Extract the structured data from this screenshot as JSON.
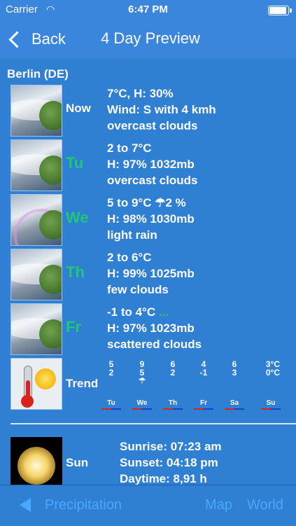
{
  "status": {
    "carrier": "Carrier",
    "time": "6:47 PM"
  },
  "nav": {
    "back_label": "Back",
    "title": "4 Day Preview"
  },
  "city": "Berlin (DE)",
  "rows": [
    {
      "day": "Now",
      "lines": [
        "7°C, H: 30%",
        "Wind: S with 4 kmh",
        "overcast clouds"
      ]
    },
    {
      "day": "Tu",
      "lines": [
        "2 to 7°C",
        "H: 97% 1032mb",
        "overcast clouds"
      ]
    },
    {
      "day": "We",
      "lines": [
        "5 to 9°C",
        "H: 98% 1030mb",
        "light rain"
      ],
      "rain_symbol": "☂",
      "rain_value": "2 %"
    },
    {
      "day": "Th",
      "lines": [
        "2 to 6°C",
        "H: 99% 1025mb",
        "few clouds"
      ]
    },
    {
      "day": "Fr",
      "lines": [
        "-1 to 4°C",
        "H: 97% 1023mb",
        "scattered clouds"
      ],
      "extra": "..."
    }
  ],
  "trend": {
    "label": "Trend",
    "columns": [
      {
        "hi": "5",
        "lo": "2",
        "day": "Tu"
      },
      {
        "hi": "9",
        "lo": "5",
        "day": "We"
      },
      {
        "hi": "6",
        "lo": "2",
        "day": "Th"
      },
      {
        "hi": "4",
        "lo": "-1",
        "day": "Fr"
      },
      {
        "hi": "6",
        "lo": "3",
        "day": "Sa"
      },
      {
        "hi": "",
        "lo": "",
        "day": "Su"
      }
    ],
    "unit_hi": "3°C",
    "unit_lo": "0°C"
  },
  "sun": {
    "label": "Sun",
    "sunrise": "Sunrise: 07:23 am",
    "sunset": "Sunset: 04:18 pm",
    "daytime": "Daytime: 8,91 h"
  },
  "toolbar": {
    "precipitation": "Precipitation",
    "map": "Map",
    "world": "World"
  },
  "colors": {
    "background": "#2f7fd3",
    "accent_green": "#20c873",
    "toolbar_link": "#4aa8ff"
  }
}
